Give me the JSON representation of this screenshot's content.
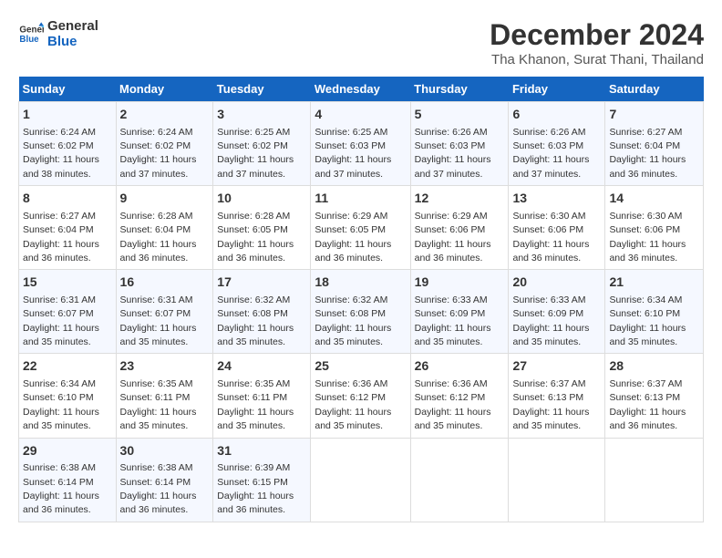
{
  "logo": {
    "line1": "General",
    "line2": "Blue"
  },
  "title": "December 2024",
  "subtitle": "Tha Khanon, Surat Thani, Thailand",
  "days_of_week": [
    "Sunday",
    "Monday",
    "Tuesday",
    "Wednesday",
    "Thursday",
    "Friday",
    "Saturday"
  ],
  "weeks": [
    [
      {
        "day": "1",
        "sunrise": "6:24 AM",
        "sunset": "6:02 PM",
        "daylight": "11 hours and 38 minutes."
      },
      {
        "day": "2",
        "sunrise": "6:24 AM",
        "sunset": "6:02 PM",
        "daylight": "11 hours and 37 minutes."
      },
      {
        "day": "3",
        "sunrise": "6:25 AM",
        "sunset": "6:02 PM",
        "daylight": "11 hours and 37 minutes."
      },
      {
        "day": "4",
        "sunrise": "6:25 AM",
        "sunset": "6:03 PM",
        "daylight": "11 hours and 37 minutes."
      },
      {
        "day": "5",
        "sunrise": "6:26 AM",
        "sunset": "6:03 PM",
        "daylight": "11 hours and 37 minutes."
      },
      {
        "day": "6",
        "sunrise": "6:26 AM",
        "sunset": "6:03 PM",
        "daylight": "11 hours and 37 minutes."
      },
      {
        "day": "7",
        "sunrise": "6:27 AM",
        "sunset": "6:04 PM",
        "daylight": "11 hours and 36 minutes."
      }
    ],
    [
      {
        "day": "8",
        "sunrise": "6:27 AM",
        "sunset": "6:04 PM",
        "daylight": "11 hours and 36 minutes."
      },
      {
        "day": "9",
        "sunrise": "6:28 AM",
        "sunset": "6:04 PM",
        "daylight": "11 hours and 36 minutes."
      },
      {
        "day": "10",
        "sunrise": "6:28 AM",
        "sunset": "6:05 PM",
        "daylight": "11 hours and 36 minutes."
      },
      {
        "day": "11",
        "sunrise": "6:29 AM",
        "sunset": "6:05 PM",
        "daylight": "11 hours and 36 minutes."
      },
      {
        "day": "12",
        "sunrise": "6:29 AM",
        "sunset": "6:06 PM",
        "daylight": "11 hours and 36 minutes."
      },
      {
        "day": "13",
        "sunrise": "6:30 AM",
        "sunset": "6:06 PM",
        "daylight": "11 hours and 36 minutes."
      },
      {
        "day": "14",
        "sunrise": "6:30 AM",
        "sunset": "6:06 PM",
        "daylight": "11 hours and 36 minutes."
      }
    ],
    [
      {
        "day": "15",
        "sunrise": "6:31 AM",
        "sunset": "6:07 PM",
        "daylight": "11 hours and 35 minutes."
      },
      {
        "day": "16",
        "sunrise": "6:31 AM",
        "sunset": "6:07 PM",
        "daylight": "11 hours and 35 minutes."
      },
      {
        "day": "17",
        "sunrise": "6:32 AM",
        "sunset": "6:08 PM",
        "daylight": "11 hours and 35 minutes."
      },
      {
        "day": "18",
        "sunrise": "6:32 AM",
        "sunset": "6:08 PM",
        "daylight": "11 hours and 35 minutes."
      },
      {
        "day": "19",
        "sunrise": "6:33 AM",
        "sunset": "6:09 PM",
        "daylight": "11 hours and 35 minutes."
      },
      {
        "day": "20",
        "sunrise": "6:33 AM",
        "sunset": "6:09 PM",
        "daylight": "11 hours and 35 minutes."
      },
      {
        "day": "21",
        "sunrise": "6:34 AM",
        "sunset": "6:10 PM",
        "daylight": "11 hours and 35 minutes."
      }
    ],
    [
      {
        "day": "22",
        "sunrise": "6:34 AM",
        "sunset": "6:10 PM",
        "daylight": "11 hours and 35 minutes."
      },
      {
        "day": "23",
        "sunrise": "6:35 AM",
        "sunset": "6:11 PM",
        "daylight": "11 hours and 35 minutes."
      },
      {
        "day": "24",
        "sunrise": "6:35 AM",
        "sunset": "6:11 PM",
        "daylight": "11 hours and 35 minutes."
      },
      {
        "day": "25",
        "sunrise": "6:36 AM",
        "sunset": "6:12 PM",
        "daylight": "11 hours and 35 minutes."
      },
      {
        "day": "26",
        "sunrise": "6:36 AM",
        "sunset": "6:12 PM",
        "daylight": "11 hours and 35 minutes."
      },
      {
        "day": "27",
        "sunrise": "6:37 AM",
        "sunset": "6:13 PM",
        "daylight": "11 hours and 35 minutes."
      },
      {
        "day": "28",
        "sunrise": "6:37 AM",
        "sunset": "6:13 PM",
        "daylight": "11 hours and 36 minutes."
      }
    ],
    [
      {
        "day": "29",
        "sunrise": "6:38 AM",
        "sunset": "6:14 PM",
        "daylight": "11 hours and 36 minutes."
      },
      {
        "day": "30",
        "sunrise": "6:38 AM",
        "sunset": "6:14 PM",
        "daylight": "11 hours and 36 minutes."
      },
      {
        "day": "31",
        "sunrise": "6:39 AM",
        "sunset": "6:15 PM",
        "daylight": "11 hours and 36 minutes."
      },
      null,
      null,
      null,
      null
    ]
  ]
}
